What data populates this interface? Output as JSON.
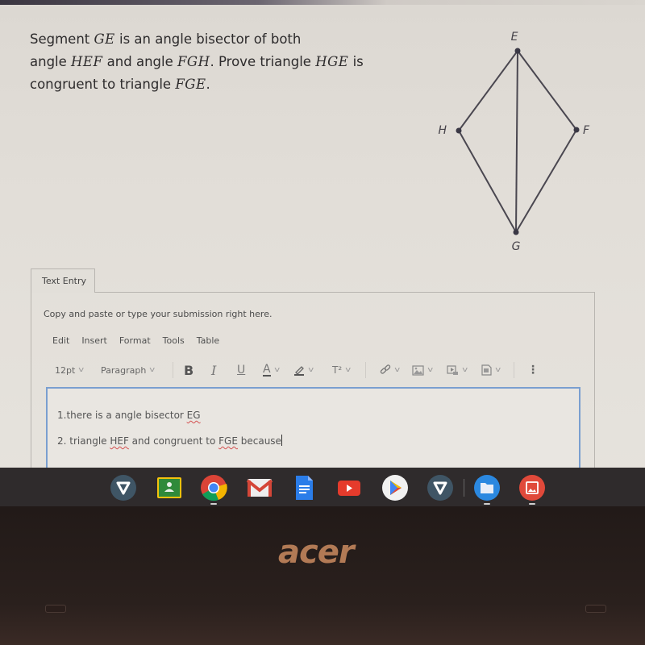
{
  "question": {
    "parts": [
      {
        "t": "Segment ",
        "m": false
      },
      {
        "t": "GE",
        "m": true
      },
      {
        "t": " is an angle bisector of both",
        "m": false
      },
      {
        "t": "\n",
        "m": false
      },
      {
        "t": "angle ",
        "m": false
      },
      {
        "t": "HEF",
        "m": true
      },
      {
        "t": " and angle ",
        "m": false
      },
      {
        "t": "FGH",
        "m": true
      },
      {
        "t": ". Prove triangle ",
        "m": false
      },
      {
        "t": "HGE",
        "m": true
      },
      {
        "t": " is",
        "m": false
      },
      {
        "t": "\n",
        "m": false
      },
      {
        "t": "congruent to triangle ",
        "m": false
      },
      {
        "t": "FGE",
        "m": true
      },
      {
        "t": ".",
        "m": false
      }
    ]
  },
  "diagram": {
    "points": {
      "E": {
        "label": "E"
      },
      "H": {
        "label": "H"
      },
      "F": {
        "label": "F"
      },
      "G": {
        "label": "G"
      }
    },
    "segments": [
      "EH",
      "EF",
      "HG",
      "FG",
      "EG"
    ],
    "line_color": "#4a4750"
  },
  "submission": {
    "tab_label": "Text Entry",
    "hint": "Copy and paste or type your submission right here.",
    "menu": [
      "Edit",
      "Insert",
      "Format",
      "Tools",
      "Table"
    ],
    "toolbar": {
      "font_size": "12pt",
      "block_format": "Paragraph",
      "bold": "B",
      "italic": "I",
      "underline": "U",
      "text_color": "A",
      "superscript": "T²",
      "more": "⋮"
    },
    "editor": {
      "line1": {
        "prefix": "1.there is a angle bisector ",
        "flagged": "EG"
      },
      "line2": {
        "prefix": "2. triangle ",
        "flagged1": "HEF",
        "middle": " and congruent to ",
        "flagged2": "FGE",
        "suffix": " because"
      }
    },
    "accent_color": "#7a9fd0"
  },
  "shelf": {
    "apps": [
      {
        "name": "vpn-shield",
        "color": "#3f5565"
      },
      {
        "name": "google-classroom",
        "color": "#2f8a3a"
      },
      {
        "name": "chrome",
        "color": "#4285f4",
        "running": true
      },
      {
        "name": "gmail",
        "color": "#d44638"
      },
      {
        "name": "google-docs",
        "color": "#2b7de9"
      },
      {
        "name": "youtube",
        "color": "#e53b2c"
      },
      {
        "name": "play-store",
        "color": "#f1f1f1"
      },
      {
        "name": "vpn-shield-2",
        "color": "#3f5565"
      },
      {
        "name": "files",
        "color": "#2b88e0",
        "running": true
      },
      {
        "name": "gallery",
        "color": "#e0493a",
        "running": true
      }
    ]
  },
  "bezel": {
    "brand": "acer",
    "brand_color": "#b27a55"
  }
}
